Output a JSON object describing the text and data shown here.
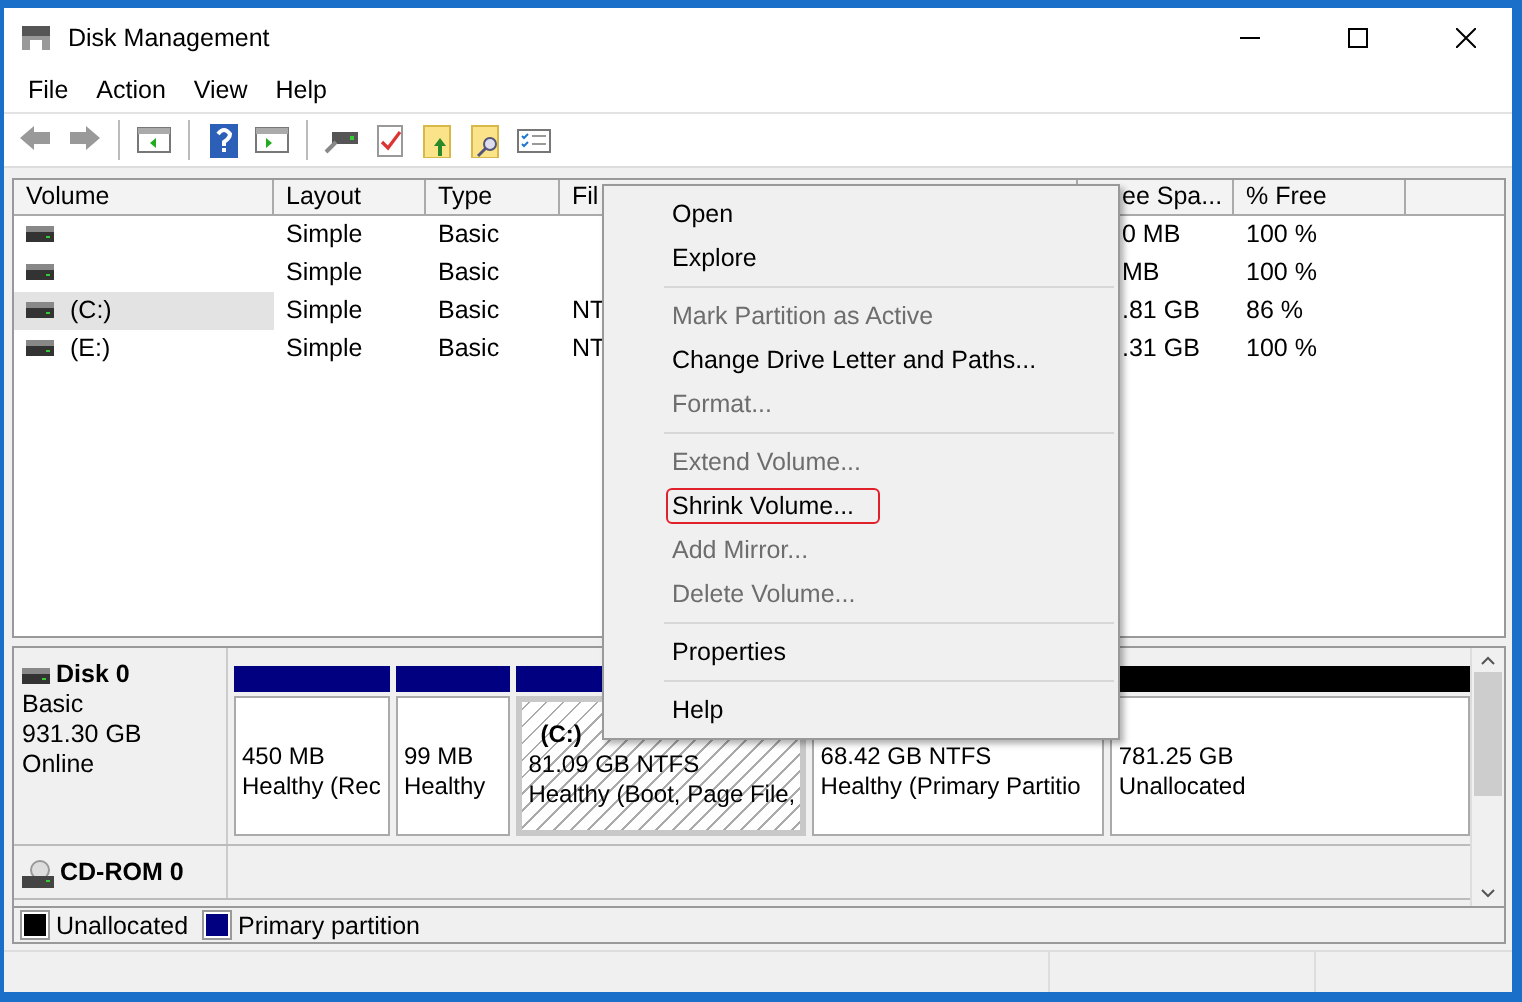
{
  "window": {
    "title": "Disk Management"
  },
  "menu": [
    "File",
    "Action",
    "View",
    "Help"
  ],
  "volume_table": {
    "columns": [
      "Volume",
      "Layout",
      "Type",
      "Fil",
      "",
      "",
      "ee Spa...",
      "% Free"
    ],
    "rows": [
      {
        "selected": false,
        "cells": [
          "",
          "Simple",
          "Basic",
          "",
          "",
          "",
          "0 MB",
          "100 %"
        ]
      },
      {
        "selected": false,
        "cells": [
          "",
          "Simple",
          "Basic",
          "",
          "",
          "",
          " MB",
          "100 %"
        ]
      },
      {
        "selected": true,
        "cells": [
          "(C:)",
          "Simple",
          "Basic",
          "NT",
          "",
          "",
          ".81 GB",
          "86 %"
        ]
      },
      {
        "selected": false,
        "cells": [
          "(E:)",
          "Simple",
          "Basic",
          "NT",
          "",
          "",
          ".31 GB",
          "100 %"
        ]
      }
    ]
  },
  "context_menu": [
    {
      "kind": "item",
      "label": "Open",
      "disabled": false,
      "highlighted": false
    },
    {
      "kind": "item",
      "label": "Explore",
      "disabled": false,
      "highlighted": false
    },
    {
      "kind": "separator"
    },
    {
      "kind": "item",
      "label": "Mark Partition as Active",
      "disabled": true,
      "highlighted": false
    },
    {
      "kind": "item",
      "label": "Change Drive Letter and Paths...",
      "disabled": false,
      "highlighted": false
    },
    {
      "kind": "item",
      "label": "Format...",
      "disabled": true,
      "highlighted": false
    },
    {
      "kind": "separator"
    },
    {
      "kind": "item",
      "label": "Extend Volume...",
      "disabled": true,
      "highlighted": false
    },
    {
      "kind": "item",
      "label": "Shrink Volume...",
      "disabled": false,
      "highlighted": true
    },
    {
      "kind": "item",
      "label": "Add Mirror...",
      "disabled": true,
      "highlighted": false
    },
    {
      "kind": "item",
      "label": "Delete Volume...",
      "disabled": true,
      "highlighted": false
    },
    {
      "kind": "separator"
    },
    {
      "kind": "item",
      "label": "Properties",
      "disabled": false,
      "highlighted": false
    },
    {
      "kind": "separator"
    },
    {
      "kind": "item",
      "label": "Help",
      "disabled": false,
      "highlighted": false
    }
  ],
  "disks": [
    {
      "kind": "disk",
      "name": "Disk 0",
      "details": [
        "Basic",
        "931.30 GB",
        "Online"
      ],
      "partitions": [
        {
          "kind": "primary",
          "selected": false,
          "size": "450 MB",
          "status": "Healthy (Rec"
        },
        {
          "kind": "primary",
          "selected": false,
          "size": "99 MB",
          "status": "Healthy"
        },
        {
          "kind": "primary",
          "selected": true,
          "label": "(C:)",
          "size": "81.09 GB NTFS",
          "status": "Healthy (Boot, Page File,"
        },
        {
          "kind": "primary",
          "selected": false,
          "size": "68.42 GB NTFS",
          "status": "Healthy (Primary Partitio"
        },
        {
          "kind": "unallocated",
          "selected": false,
          "size": "781.25 GB",
          "status": "Unallocated"
        }
      ]
    },
    {
      "kind": "cdrom",
      "name": "CD-ROM 0"
    }
  ],
  "legend": [
    {
      "label": "Unallocated",
      "color": "#000000"
    },
    {
      "label": "Primary partition",
      "color": "#000080"
    }
  ]
}
